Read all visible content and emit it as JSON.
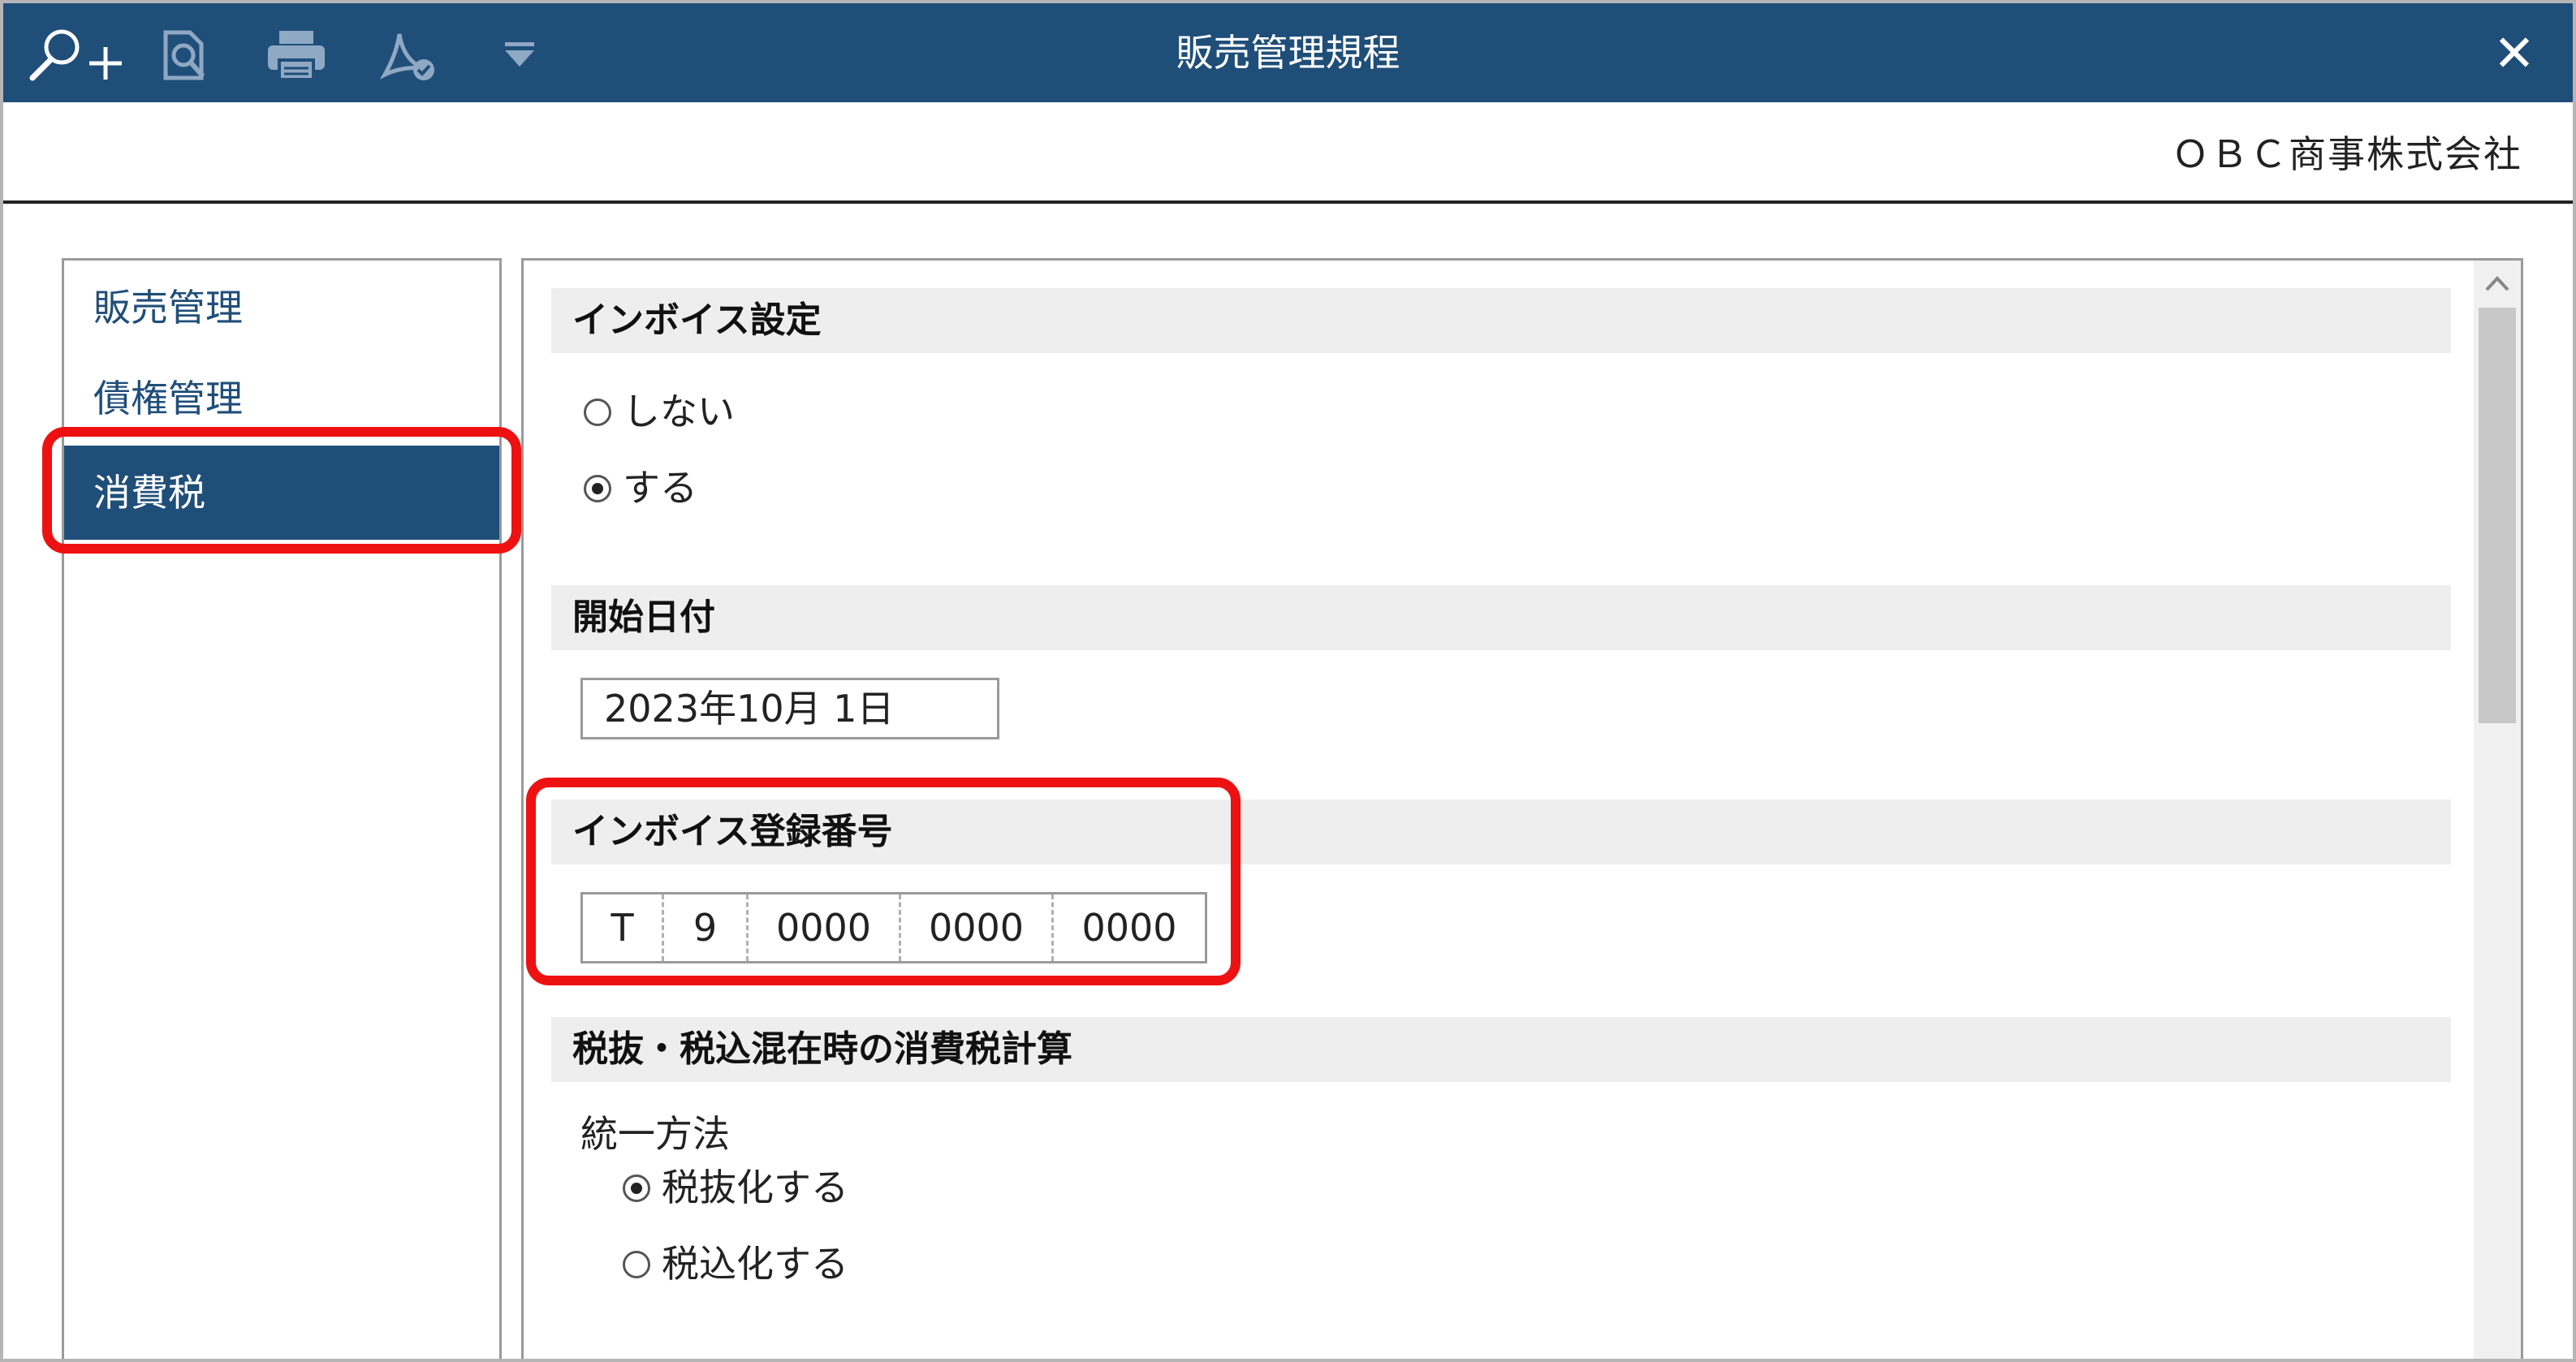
{
  "window": {
    "title": "販売管理規程",
    "close_label": "✕"
  },
  "toolbar": {
    "icons": [
      "zoom-in-icon",
      "preview-search-icon",
      "print-icon",
      "pdf-sign-icon",
      "dropdown-icon"
    ]
  },
  "company_name": "ＯＢＣ商事株式会社",
  "sidebar": {
    "items": [
      {
        "label": "販売管理",
        "active": false
      },
      {
        "label": "債権管理",
        "active": false
      },
      {
        "label": "消費税",
        "active": true
      }
    ]
  },
  "main": {
    "invoice_setting": {
      "heading": "インボイス設定",
      "options": [
        {
          "label": "しない",
          "checked": false
        },
        {
          "label": "する",
          "checked": true
        }
      ]
    },
    "start_date": {
      "heading": "開始日付",
      "value": "2023年10月  1日"
    },
    "registration_number": {
      "heading": "インボイス登録番号",
      "segments": [
        "T",
        "9",
        "0000",
        "0000",
        "0000"
      ]
    },
    "mixed_tax_calc": {
      "heading": "税抜・税込混在時の消費税計算",
      "sub_label": "統一方法",
      "options": [
        {
          "label": "税抜化する",
          "checked": true
        },
        {
          "label": "税込化する",
          "checked": false
        }
      ]
    }
  },
  "colors": {
    "titlebar": "#1f4e79",
    "highlight": "#ee1111",
    "section_bg": "#eeeeee"
  }
}
